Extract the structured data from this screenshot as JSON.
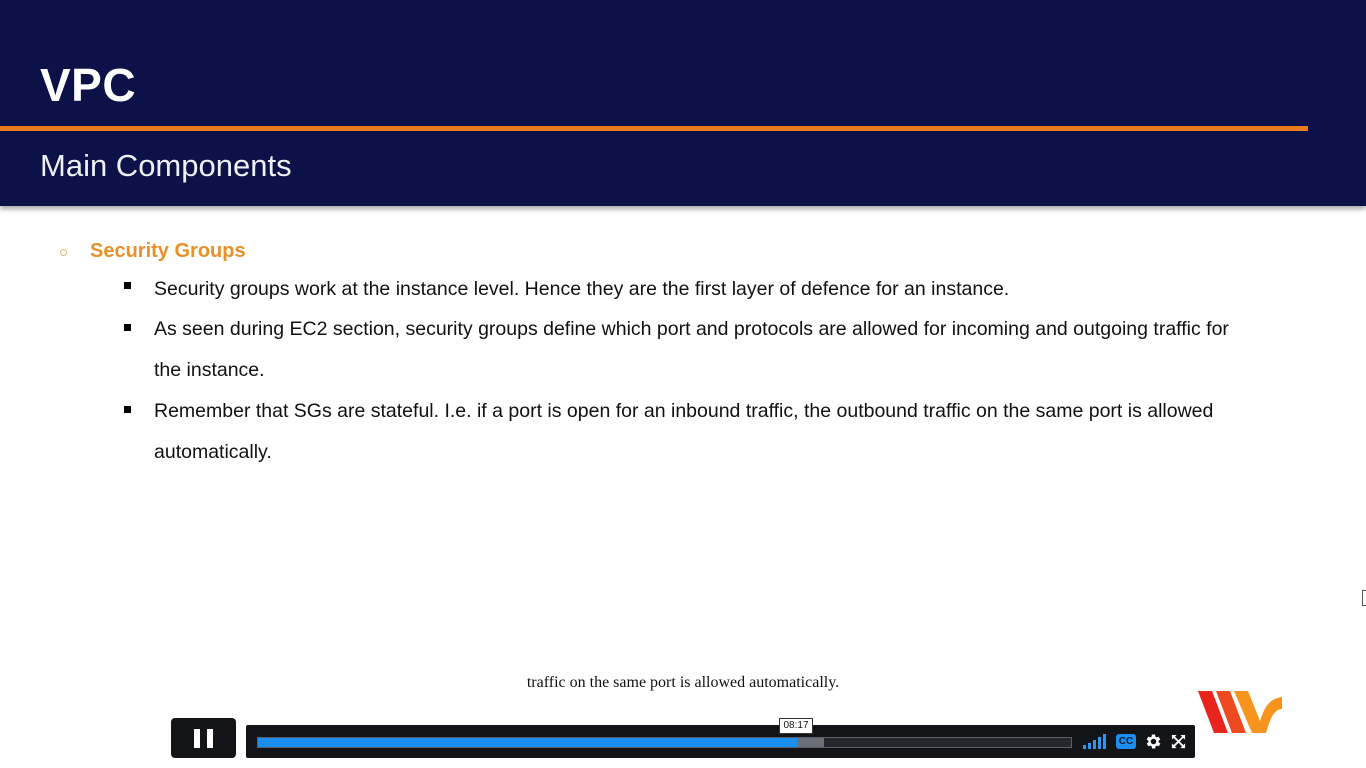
{
  "slide": {
    "title": "VPC",
    "subtitle": "Main Components",
    "section": {
      "bullet": "○",
      "heading": "Security Groups",
      "items": [
        "Security groups work at the instance level. Hence they are the first layer of defence for an instance.",
        "As seen during EC2 section, security groups define which port and protocols are allowed for incoming and outgoing traffic for the instance.",
        "Remember that SGs are stateful. I.e. if a port is open for an inbound traffic, the outbound traffic on the same port is allowed automatically."
      ]
    },
    "colors": {
      "header_bg": "#0c1147",
      "accent_orange": "#e87c1e",
      "heading_orange": "#e8902a"
    }
  },
  "caption": {
    "text": "traffic on the same port is allowed automatically."
  },
  "player": {
    "play_state": "playing",
    "pause_icon": "pause-icon",
    "current_time_tooltip": "08:17",
    "progress_played_fraction": 0.663,
    "progress_buffered_fraction": 0.696,
    "volume_icon": "volume-bars-icon",
    "cc_label": "CC",
    "settings_icon": "gear-icon",
    "fullscreen_icon": "expand-icon",
    "accent_color": "#1a8ff0"
  },
  "logo": {
    "name": "brand-logo",
    "colors": [
      "#e8241c",
      "#f7941d"
    ]
  }
}
